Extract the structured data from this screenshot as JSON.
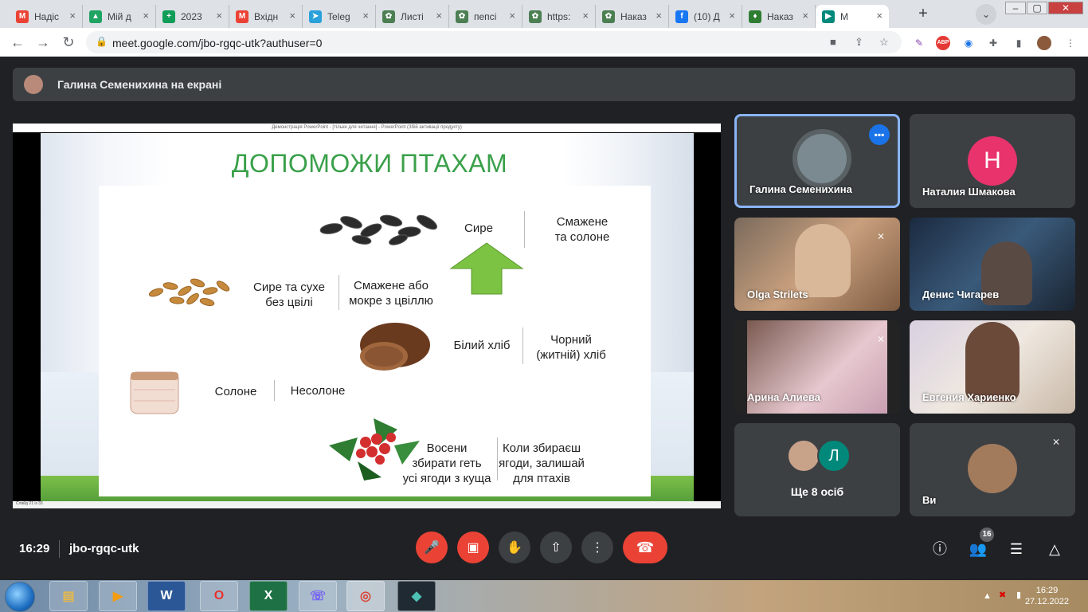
{
  "browser": {
    "tabs": [
      {
        "label": "Надіс",
        "icon": "gmail-icon",
        "color": "#ea4335",
        "glyph": "M"
      },
      {
        "label": "Мій д",
        "icon": "google-drive-icon",
        "color": "#1fa463",
        "glyph": "▲"
      },
      {
        "label": "2023",
        "icon": "google-sheets-icon",
        "color": "#0f9d58",
        "glyph": "+"
      },
      {
        "label": "Вхідн",
        "icon": "gmail-icon",
        "color": "#ea4335",
        "glyph": "M"
      },
      {
        "label": "Teleg",
        "icon": "telegram-icon",
        "color": "#2aa1da",
        "glyph": "➤"
      },
      {
        "label": "Листі",
        "icon": "site-icon",
        "color": "#4b7f52",
        "glyph": "✿"
      },
      {
        "label": "пепсі",
        "icon": "site-icon",
        "color": "#4b7f52",
        "glyph": "✿"
      },
      {
        "label": "https:",
        "icon": "site-icon",
        "color": "#4b7f52",
        "glyph": "✿"
      },
      {
        "label": "Наказ",
        "icon": "site-icon",
        "color": "#4b7f52",
        "glyph": "✿"
      },
      {
        "label": "(10) Д",
        "icon": "facebook-icon",
        "color": "#1877f2",
        "glyph": "f"
      },
      {
        "label": "Наказ",
        "icon": "shield-icon",
        "color": "#2e7d32",
        "glyph": "♦"
      },
      {
        "label": "M",
        "icon": "google-meet-icon",
        "color": "#00897b",
        "glyph": "▶"
      }
    ],
    "url": "meet.google.com/jbo-rgqc-utk?authuser=0"
  },
  "presentation_banner": {
    "text": "Галина Семенихина на екрані"
  },
  "ppt": {
    "window_title": "Демонстрація PowerPoint - [тільки для читання] - PowerPoint (Збій активації продукту)",
    "status": "Слайд 21 із 33"
  },
  "slide": {
    "title": "ДОПОМОЖИ ПТАХАМ",
    "texts": {
      "raw": "Сире",
      "fried_salted": "Смажене\nта солоне",
      "raw_dry": "Сире та сухе\nбез цвілі",
      "fried_wet": "Смажене або\nмокре з цвіллю",
      "white_bread": "Білий хліб",
      "black_bread": "Чорний\n(житній) хліб",
      "salted": "Солоне",
      "unsalted": "Несолоне",
      "autumn": "Восени\nзбирати геть\nусі ягоди з куща",
      "when_pick": "Коли збираєш\nягоди, залишай\nдля птахів"
    }
  },
  "participants": [
    {
      "name": "Галина Семенихина",
      "muted": false,
      "speaking": true
    },
    {
      "name": "Наталия Шмакова",
      "muted": false,
      "initial": "Н",
      "avatar_color": "#e8336d"
    },
    {
      "name": "Olga Strilets",
      "muted": true
    },
    {
      "name": "Денис Чигарев",
      "muted": false
    },
    {
      "name": "Арина Алиева",
      "muted": true
    },
    {
      "name": "Евгения Хариенко",
      "muted": false
    },
    {
      "name": "Ще 8 осіб",
      "initial": "Л",
      "avatar_color": "#00897b"
    },
    {
      "name": "Ви",
      "muted": true
    }
  ],
  "meeting": {
    "time": "16:29",
    "code": "jbo-rgqc-utk",
    "participant_count": "16"
  },
  "taskbar": {
    "apps": [
      "explorer-icon",
      "media-player-icon",
      "word-icon",
      "opera-icon",
      "excel-icon",
      "viber-icon",
      "chrome-icon",
      "filmora-icon"
    ],
    "time": "16:29",
    "date": "27.12.2022"
  }
}
